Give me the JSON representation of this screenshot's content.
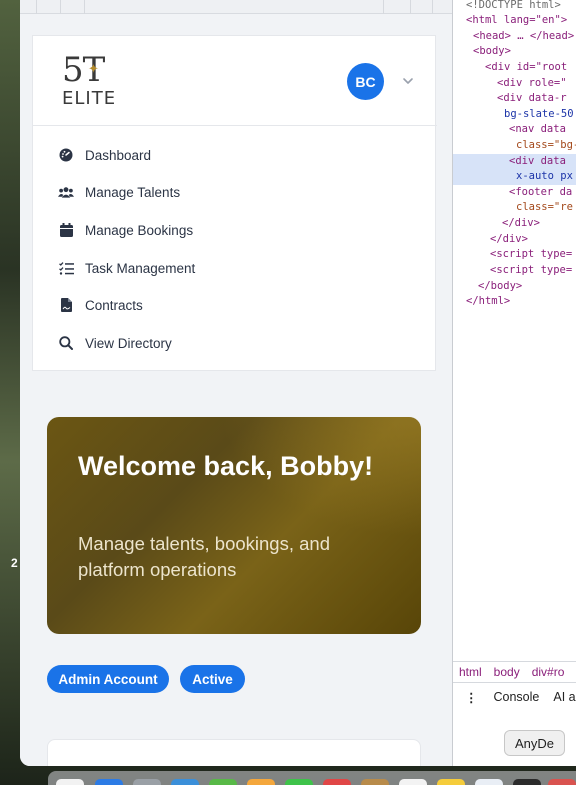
{
  "desktop": {
    "partial_label": "2"
  },
  "app": {
    "logo": {
      "top": "5T",
      "bottom": "ELITE"
    },
    "user": {
      "initials": "BC"
    },
    "menu": [
      {
        "label": "Dashboard",
        "icon": "gauge-icon"
      },
      {
        "label": "Manage Talents",
        "icon": "users-icon"
      },
      {
        "label": "Manage Bookings",
        "icon": "calendar-icon"
      },
      {
        "label": "Task Management",
        "icon": "checklist-icon"
      },
      {
        "label": "Contracts",
        "icon": "document-icon"
      },
      {
        "label": "View Directory",
        "icon": "search-icon"
      }
    ],
    "banner": {
      "title": "Welcome back, Bobby!",
      "subtitle": "Manage talents, bookings, and platform operations"
    },
    "badges": {
      "account": "Admin Account",
      "status": "Active"
    }
  },
  "devtools": {
    "lines": [
      "<!DOCTYPE html>",
      "<html lang=\"en\">",
      "<head> … </head>",
      "<body>",
      "<div id=\"root",
      "<div role=\"",
      "<div data-r",
      "bg-slate-50",
      "<nav data",
      "class=\"bg-",
      "<div data",
      "x-auto px",
      "<footer da",
      "class=\"re",
      "</div>",
      "</div>",
      "<script type=",
      "<script type=",
      "</body>",
      "</html>"
    ],
    "breadcrumb": [
      "html",
      "body",
      "div#ro"
    ],
    "console_tab": "Console",
    "ai_tab": "AI a",
    "tooltip": "AnyDe"
  },
  "colors": {
    "accent": "#1a73e8",
    "banner_gold": "#6b5613"
  }
}
